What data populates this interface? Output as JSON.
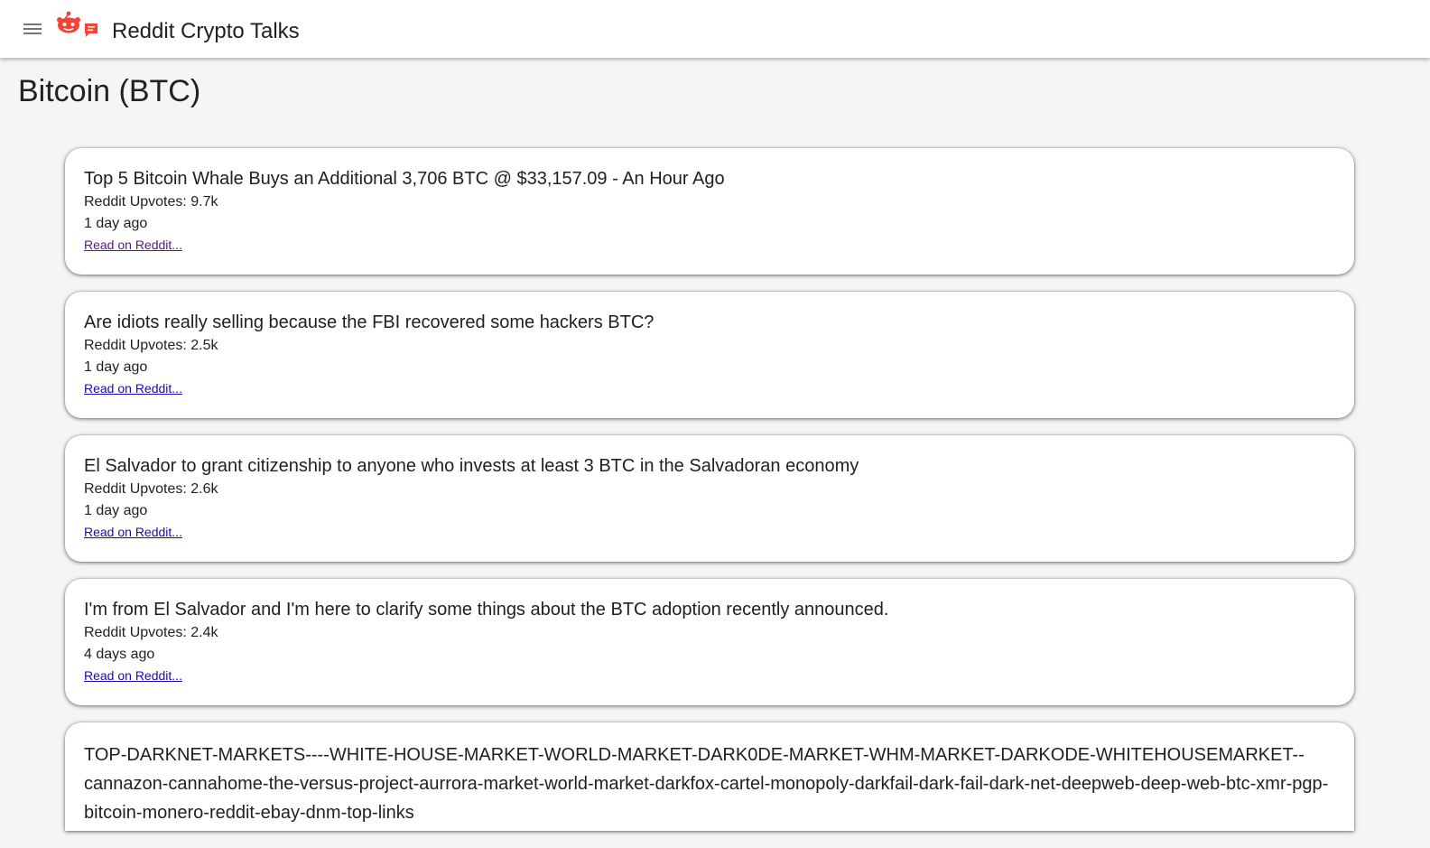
{
  "header": {
    "title": "Reddit Crypto Talks",
    "menu_icon": "hamburger-menu-icon",
    "logo_icon": "reddit-chat-logo-icon",
    "accent_color": "#ff4500"
  },
  "page": {
    "title": "Bitcoin (BTC)"
  },
  "posts": [
    {
      "title": "Top 5 Bitcoin Whale Buys an Additional 3,706 BTC @ $33,157.09 - An Hour Ago",
      "upvotes": "Reddit Upvotes: 9.7k",
      "age": "1 day ago",
      "link": "Read on Reddit...",
      "visited": true
    },
    {
      "title": "Are idiots really selling because the FBI recovered some hackers BTC?",
      "upvotes": "Reddit Upvotes: 2.5k",
      "age": "1 day ago",
      "link": "Read on Reddit...",
      "visited": false
    },
    {
      "title": "El Salvador to grant citizenship to anyone who invests at least 3 BTC in the Salvadoran economy",
      "upvotes": "Reddit Upvotes: 2.6k",
      "age": "1 day ago",
      "link": "Read on Reddit...",
      "visited": false
    },
    {
      "title": "I'm from El Salvador and I'm here to clarify some things about the BTC adoption recently announced.",
      "upvotes": "Reddit Upvotes: 2.4k",
      "age": "4 days ago",
      "link": "Read on Reddit...",
      "visited": false
    },
    {
      "title": "TOP-DARKNET-MARKETS----WHITE-HOUSE-MARKET-WORLD-MARKET-DARK0DE-MARKET-WHM-MARKET-DARKODE-WHITEHOUSEMARKET--cannazon-cannahome-the-versus-project-aurrora-market-world-market-darkfox-cartel-monopoly-darkfail-dark-fail-dark-net-deepweb-deep-web-btc-xmr-pgp-bitcoin-monero-reddit-ebay-dnm-top-links"
    }
  ]
}
